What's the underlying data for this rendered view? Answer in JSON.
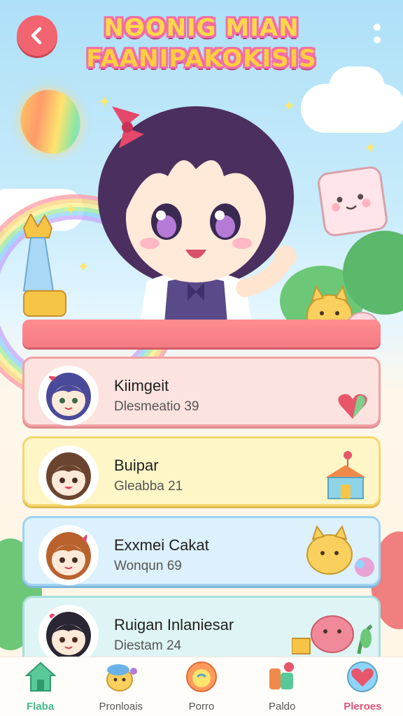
{
  "header": {
    "title_line1": "NӨONIG MIAN",
    "title_line2": "FAANIPAKOKISIS"
  },
  "icons": {
    "back": "back-arrow-icon",
    "more": "more-vertical-icon"
  },
  "list": [
    {
      "name": "Kiimgeit",
      "sub": "Dlesmeatio 39",
      "bg": "#fde3df",
      "border": "#f3a1a4",
      "deco": "heart-icon"
    },
    {
      "name": "Buipar",
      "sub": "Gleabba 21",
      "bg": "#fff6c7",
      "border": "#f5d66e",
      "deco": "house-icon"
    },
    {
      "name": "Exxmei Cakat",
      "sub": "Wonqun 69",
      "bg": "#dcf1fb",
      "border": "#9fd3f1",
      "deco": "cat-buddy-icon"
    },
    {
      "name": "Ruigan Inlaniesar",
      "sub": "Diestam 24",
      "bg": "#dff4f4",
      "border": "#a8dede",
      "deco": "pink-buddy-icon"
    }
  ],
  "nav": [
    {
      "label": "Flaba",
      "icon": "home-icon",
      "color": "#46b98a",
      "active": true
    },
    {
      "label": "Pronloais",
      "icon": "buddy-icon",
      "color": "#555555"
    },
    {
      "label": "Porro",
      "icon": "face-icon",
      "color": "#555555"
    },
    {
      "label": "Paldo",
      "icon": "puzzle-icon",
      "color": "#555555"
    },
    {
      "label": "Pleroes",
      "icon": "heart-badge-icon",
      "color": "#e0547a"
    }
  ]
}
